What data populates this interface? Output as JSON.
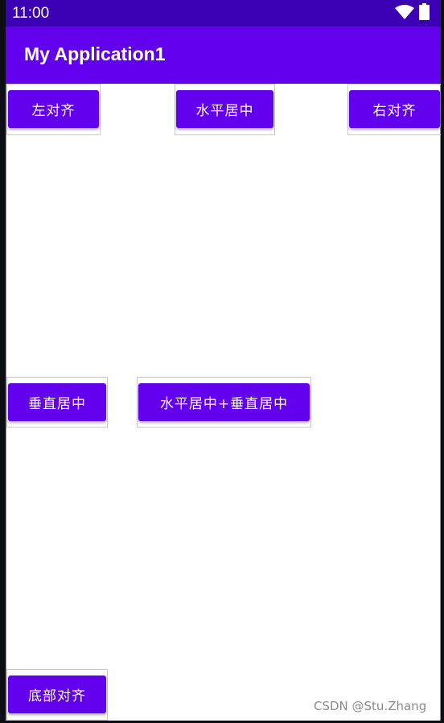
{
  "status_bar": {
    "time": "11:00",
    "icons": [
      "wifi-icon",
      "battery-icon"
    ],
    "color": "#3b00b3"
  },
  "app_bar": {
    "title": "My Application1",
    "color": "#6200ee"
  },
  "buttons": {
    "left": "左对齐",
    "center_horizontal": "水平居中",
    "right": "右对齐",
    "center_vertical": "垂直居中",
    "center_both": "水平居中+垂直居中",
    "bottom": "底部对齐"
  },
  "watermark": "CSDN @Stu.Zhang"
}
